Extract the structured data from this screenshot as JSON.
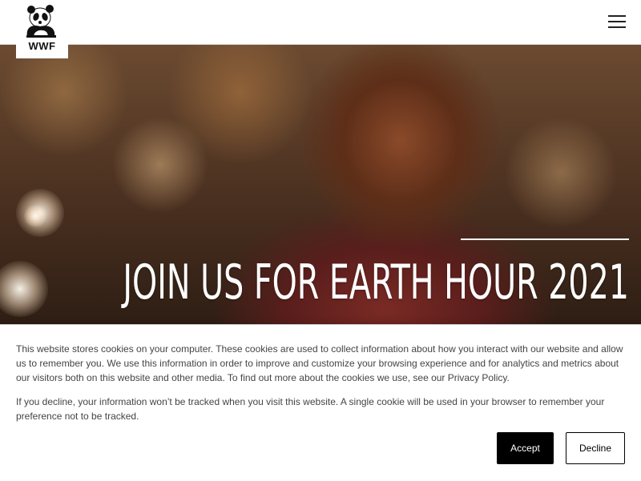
{
  "header": {
    "logo_text": "WWF",
    "menu_icon": "hamburger-menu-icon"
  },
  "hero": {
    "headline": "JOIN US FOR EARTH HOUR 2021"
  },
  "cookie_banner": {
    "paragraph_1": "This website stores cookies on your computer. These cookies are used to collect information about how you interact with our website and allow us to remember you. We use this information in order to improve and customize your browsing experience and for analytics and metrics about our visitors both on this website and other media. To find out more about the cookies we use, see our Privacy Policy.",
    "paragraph_2": "If you decline, your information won’t be tracked when you visit this website. A single cookie will be used in your browser to remember your preference not to be tracked.",
    "accept_label": "Accept",
    "decline_label": "Decline"
  },
  "colors": {
    "accept_bg": "#000000",
    "banner_text": "#444444",
    "headline_text": "#ffffff"
  }
}
